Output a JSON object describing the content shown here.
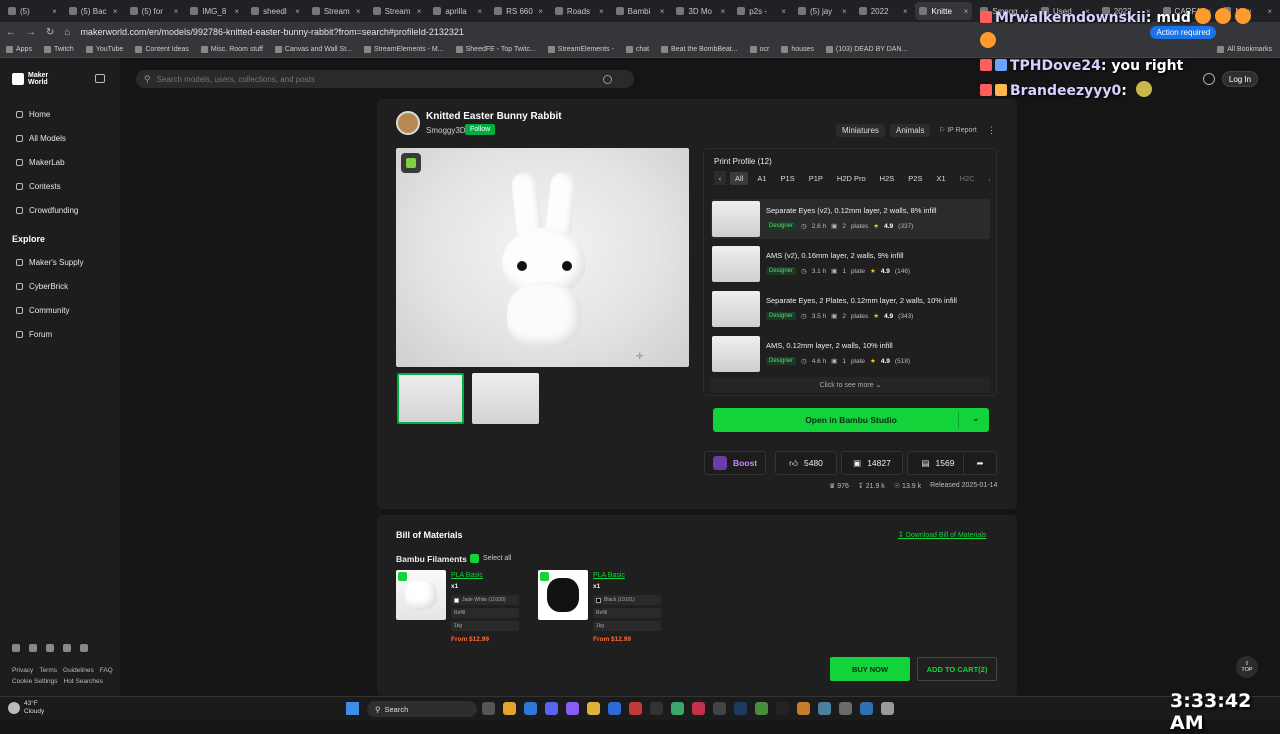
{
  "browser": {
    "tabs": [
      "(5)",
      "(5) Bac",
      "(5) for",
      "IMG_8",
      "sheedl",
      "Stream",
      "Stream",
      "aprilla",
      "RS 660",
      "Roads",
      "Bambi",
      "3D Mo",
      "p2s -",
      "(5) jay",
      "2022",
      "Knitte",
      "Smogg",
      "Used",
      "2022",
      "CARFA",
      "New"
    ],
    "active_tab_index": 15,
    "url": "makerworld.com/en/models/992786-knitted-easter-bunny-rabbit?from=search#profileId-2132321",
    "action_required": "Action required",
    "bookmarks": [
      "Apps",
      "Twitch",
      "YouTube",
      "Content Ideas",
      "Misc. Room stuff",
      "Canvas and Wall St...",
      "StreamElements - M...",
      "SheedFE - Top Twitc...",
      "StreamElements -",
      "chat",
      "Beat the BombBeat...",
      "ocr",
      "houses",
      "(103) DEAD BY DAN..."
    ],
    "all_bookmarks": "All Bookmarks"
  },
  "sidebar": {
    "logo_line1": "Maker",
    "logo_line2": "World",
    "nav": [
      {
        "label": "Home",
        "icon": "home-icon"
      },
      {
        "label": "All Models",
        "icon": "models-icon"
      },
      {
        "label": "MakerLab",
        "icon": "makerlab-icon"
      },
      {
        "label": "Contests",
        "icon": "trophy-icon"
      },
      {
        "label": "Crowdfunding",
        "icon": "crowdfunding-icon"
      }
    ],
    "explore_heading": "Explore",
    "explore": [
      {
        "label": "Maker's Supply",
        "icon": "supply-icon"
      },
      {
        "label": "CyberBrick",
        "icon": "cyberbrick-icon"
      },
      {
        "label": "Community",
        "icon": "community-icon"
      },
      {
        "label": "Forum",
        "icon": "forum-icon"
      }
    ],
    "footer_links1": [
      "Privacy",
      "Terms",
      "Guidelines",
      "FAQ"
    ],
    "footer_links2": [
      "Cookie Settings",
      "Hot Searches"
    ]
  },
  "header": {
    "search_placeholder": "Search models, users, collections, and posts",
    "login": "Log In"
  },
  "model": {
    "title": "Knitted Easter Bunny Rabbit",
    "author": "Smoggy3D",
    "follow": "Follow",
    "tags": [
      "Miniatures",
      "Animals"
    ],
    "ip_report": "IP Report",
    "print_profile_title": "Print Profile (12)",
    "printer_tabs": [
      "All",
      "A1",
      "P1S",
      "P1P",
      "H2D Pro",
      "H2S",
      "P2S",
      "X1",
      "H2C",
      "A1"
    ],
    "profiles": [
      {
        "name": "Separate Eyes (v2), 0.12mm layer, 2 walls, 8% infill",
        "badge": "Designer",
        "time": "2.6 h",
        "plates": "2",
        "plates_label": "plates",
        "rating": "4.9",
        "count": "(337)"
      },
      {
        "name": "AMS (v2), 0.16mm layer, 2 walls, 9% infill",
        "badge": "Designer",
        "time": "3.1 h",
        "plates": "1",
        "plates_label": "plate",
        "rating": "4.9",
        "count": "(146)"
      },
      {
        "name": "Separate Eyes, 2 Plates, 0.12mm layer, 2 walls, 10% infill",
        "badge": "Designer",
        "time": "3.5 h",
        "plates": "2",
        "plates_label": "plates",
        "rating": "4.9",
        "count": "(343)"
      },
      {
        "name": "AMS, 0.12mm layer, 2 walls, 10% infill",
        "badge": "Designer",
        "time": "4.6 h",
        "plates": "1",
        "plates_label": "plate",
        "rating": "4.9",
        "count": "(518)"
      }
    ],
    "see_more": "Click to see more",
    "open_button": "Open in Bambu Studio",
    "boost": "Boost",
    "likes": "5480",
    "collects": "14827",
    "comments": "1569",
    "prints": "976",
    "downloads": "21.9 k",
    "views": "13.9 k",
    "released": "Released 2025-01-14"
  },
  "bom": {
    "title": "Bill of Materials",
    "download": "Download Bill of Materials",
    "filaments_title": "Bambu Filaments",
    "select_all": "Select all",
    "filaments": [
      {
        "name": "PLA Basic",
        "qty": "x1",
        "color_label": "Jade White (10100)",
        "swatch": "#ffffff",
        "refill": "Refill",
        "weight": "1kg",
        "price": "From $12.99"
      },
      {
        "name": "PLA Basic",
        "qty": "x1",
        "color_label": "Black (10101)",
        "swatch": "#000000",
        "refill": "Refill",
        "weight": "1kg",
        "price": "From $12.99"
      }
    ],
    "buy_now": "BUY NOW",
    "add_to_cart": "ADD TO CART(2)",
    "top": "TOP"
  },
  "chat": [
    {
      "user": "Mrwalkemdownskii",
      "message": "mud"
    },
    {
      "user": "TPHDove24",
      "message": "you right"
    },
    {
      "user": "Brandeezyyy0",
      "message": ""
    }
  ],
  "taskbar": {
    "temp": "43°F",
    "weather": "Cloudy",
    "search": "Search",
    "clock": "3:33:42 AM"
  }
}
